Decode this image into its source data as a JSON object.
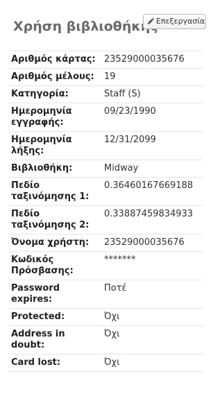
{
  "header": {
    "title": "Χρήση βιβλιοθήκης",
    "edit_label": "Επεξεργασία",
    "edit_icon": "pencil-icon"
  },
  "fields": [
    {
      "label": "Αριθμός κάρτας:",
      "value": "23529000035676"
    },
    {
      "label": "Αριθμός μέλους:",
      "value": "19"
    },
    {
      "label": "Κατηγορία:",
      "value": "Staff (S)"
    },
    {
      "label": "Ημερομηνία εγγραφής:",
      "value": "09/23/1990"
    },
    {
      "label": "Ημερομηνία λήξης:",
      "value": "12/31/2099"
    },
    {
      "label": "Βιβλιοθήκη:",
      "value": "Midway"
    },
    {
      "label": "Πεδίο ταξινόμησης 1:",
      "value": "0.36460167669188"
    },
    {
      "label": "Πεδίο ταξινόμησης 2:",
      "value": "0.33887459834933"
    },
    {
      "label": "Όνομα χρήστη:",
      "value": "23529000035676"
    },
    {
      "label": "Κωδικός Πρόσβασης:",
      "value": "*******"
    },
    {
      "label": "Password expires:",
      "value": "Ποτέ"
    },
    {
      "label": "Protected:",
      "value": "Όχι"
    },
    {
      "label": "Address in doubt:",
      "value": "Όχι"
    },
    {
      "label": "Card lost:",
      "value": "Όχι"
    }
  ]
}
